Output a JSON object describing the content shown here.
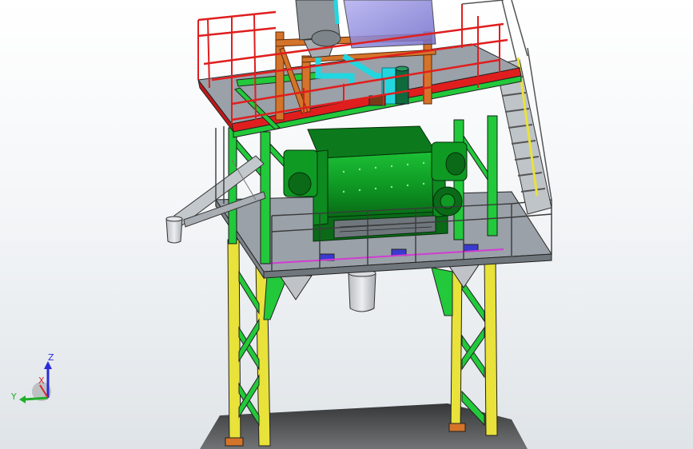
{
  "viewport": {
    "background_top": "#ffffff",
    "background_bottom": "#dfe4e8"
  },
  "model": {
    "colors": {
      "frame_green": "#22c93a",
      "leg_yellow": "#e8e23a",
      "rail_red": "#e01e1e",
      "platform_gray": "#9aa1a8",
      "mixer_green": "#0f9a24",
      "mixer_dark": "#0a6a18",
      "bin_blue": "#8a86d8",
      "pipe_cyan": "#22d6e0",
      "brace_orange": "#d4742a",
      "hopper_gray": "#c9cdd1"
    }
  },
  "triad": {
    "z_label": "Z",
    "x_label": "X",
    "y_label": "Y",
    "z_color": "#2a2adb",
    "x_color": "#d82a2a",
    "y_color": "#1fae2a"
  }
}
